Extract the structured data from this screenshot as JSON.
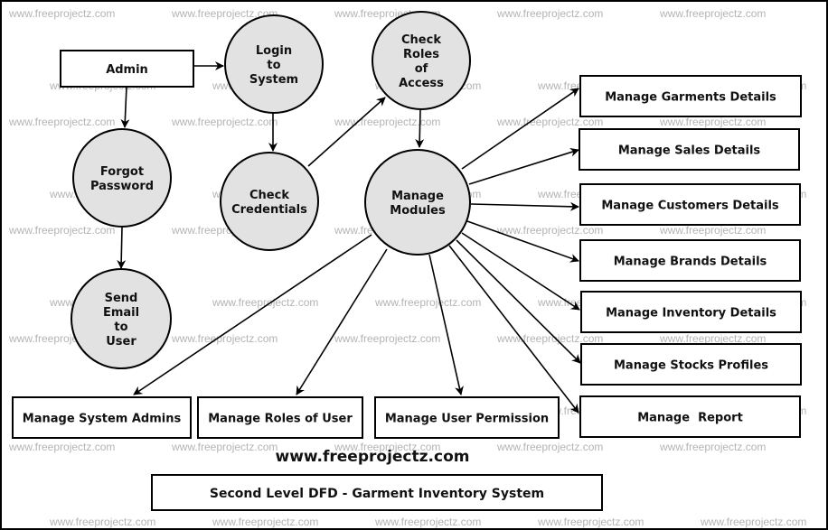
{
  "diagram": {
    "title": "Second Level DFD - Garment Inventory System",
    "website": "www.freeprojectz.com",
    "watermark": "www.freeprojectz.com",
    "colors": {
      "process_fill": "#e2e2e2",
      "stroke": "#000000",
      "watermark": "#b4b4b4"
    },
    "entities": [
      {
        "id": "admin",
        "label": "Admin"
      },
      {
        "id": "garments",
        "label": "Manage Garments Details"
      },
      {
        "id": "sales",
        "label": "Manage Sales Details"
      },
      {
        "id": "customers",
        "label": "Manage Customers Details"
      },
      {
        "id": "brands",
        "label": "Manage Brands Details"
      },
      {
        "id": "inventory",
        "label": "Manage Inventory Details"
      },
      {
        "id": "stocks",
        "label": "Manage Stocks Profiles"
      },
      {
        "id": "report",
        "label": "Manage  Report"
      },
      {
        "id": "sysadmins",
        "label": "Manage System Admins"
      },
      {
        "id": "roles",
        "label": "Manage Roles of User"
      },
      {
        "id": "permission",
        "label": "Manage User Permission"
      }
    ],
    "processes": [
      {
        "id": "login",
        "lines": [
          "Login",
          "to",
          "System"
        ]
      },
      {
        "id": "checkroles",
        "lines": [
          "Check",
          "Roles",
          "of",
          "Access"
        ]
      },
      {
        "id": "forgot",
        "lines": [
          "Forgot",
          "Password"
        ]
      },
      {
        "id": "checkcred",
        "lines": [
          "Check",
          "Credentials"
        ]
      },
      {
        "id": "modules",
        "lines": [
          "Manage",
          "Modules"
        ]
      },
      {
        "id": "email",
        "lines": [
          "Send",
          "Email",
          "to",
          "User"
        ]
      }
    ],
    "flows": [
      {
        "from": "admin",
        "to": "login"
      },
      {
        "from": "admin",
        "to": "forgot"
      },
      {
        "from": "login",
        "to": "checkcred"
      },
      {
        "from": "checkcred",
        "to": "checkroles"
      },
      {
        "from": "checkroles",
        "to": "modules"
      },
      {
        "from": "forgot",
        "to": "email"
      },
      {
        "from": "modules",
        "to": "garments"
      },
      {
        "from": "modules",
        "to": "sales"
      },
      {
        "from": "modules",
        "to": "customers"
      },
      {
        "from": "modules",
        "to": "brands"
      },
      {
        "from": "modules",
        "to": "inventory"
      },
      {
        "from": "modules",
        "to": "stocks"
      },
      {
        "from": "modules",
        "to": "report"
      },
      {
        "from": "modules",
        "to": "sysadmins"
      },
      {
        "from": "modules",
        "to": "roles"
      },
      {
        "from": "modules",
        "to": "permission"
      }
    ]
  }
}
